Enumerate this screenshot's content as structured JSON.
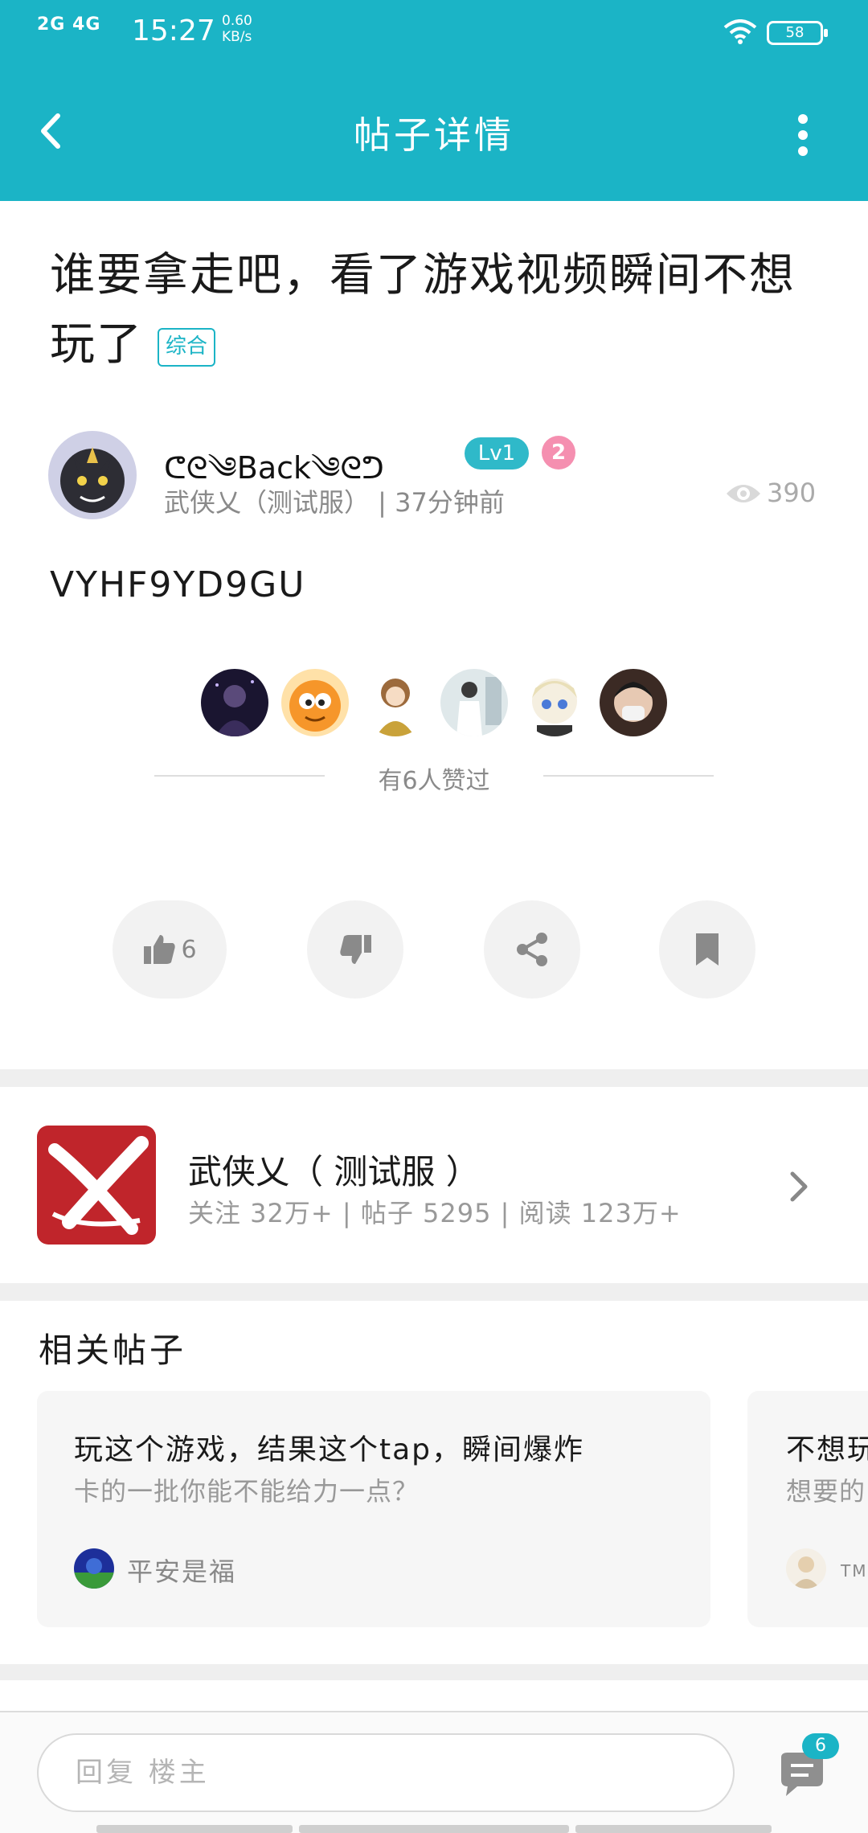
{
  "status_bar": {
    "network": "2G 4G",
    "time": "15:27",
    "speed_value": "0.60",
    "speed_unit": "KB/s",
    "battery": "58"
  },
  "app_bar": {
    "title": "帖子详情"
  },
  "post": {
    "title": "谁要拿走吧，看了游戏视频瞬间不想玩了",
    "tag": "综合",
    "author": {
      "name": "ᕦᘓ༄Back༄ᘓᕤ",
      "level": "Lv1",
      "medal": "2",
      "meta": "武侠乂（测试服） | 37分钟前"
    },
    "views": "390",
    "body": "VYHF9YD9GU"
  },
  "likes": {
    "text": "有6人赞过"
  },
  "actions": {
    "like_count": "6"
  },
  "game": {
    "name": "武侠乂（ 测试服 ）",
    "stats": "关注 32万+  |  帖子 5295  |  阅读 123万+"
  },
  "related": {
    "title": "相关帖子",
    "posts": [
      {
        "title": "玩这个游戏，结果这个tap，瞬间爆炸",
        "subtitle": "卡的一批你能不能给力一点？",
        "user": "平安是福"
      },
      {
        "title": "不想玩",
        "subtitle": "想要的",
        "user": "TM"
      }
    ]
  },
  "reply": {
    "placeholder": "回复 楼主",
    "comment_count": "6"
  },
  "colors": {
    "accent": "#1bb4c6",
    "level_badge": "#2fb9c9",
    "medal": "#f58fb0",
    "game_icon": "#c0252b"
  }
}
